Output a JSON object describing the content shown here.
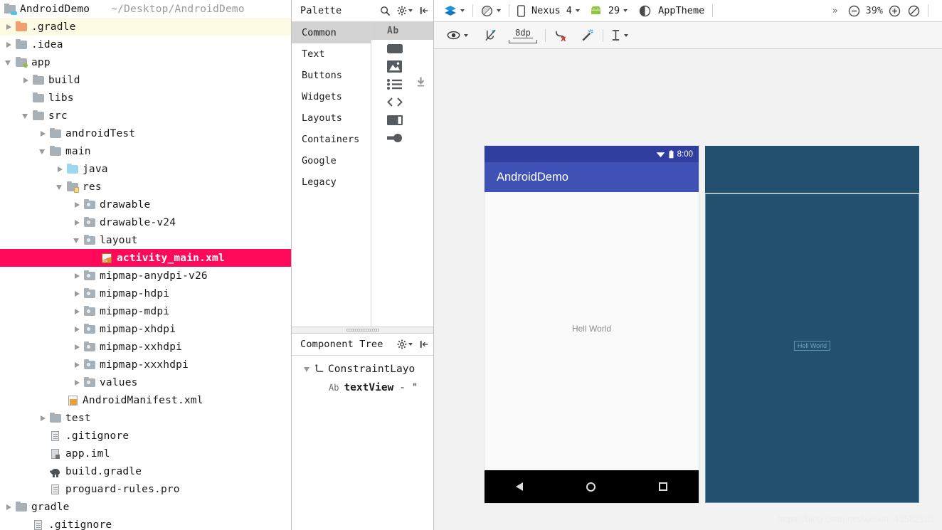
{
  "project": {
    "root_name": "AndroidDemo",
    "root_path": "~/Desktop/AndroidDemo",
    "tree": [
      {
        "label": ".gradle",
        "indent": 0,
        "arrow": "right",
        "icon": "folder-orange",
        "hl": "yellow"
      },
      {
        "label": ".idea",
        "indent": 0,
        "arrow": "right",
        "icon": "folder",
        "hl": "none"
      },
      {
        "label": "app",
        "indent": 0,
        "arrow": "down",
        "icon": "folder-module",
        "hl": "none"
      },
      {
        "label": "build",
        "indent": 1,
        "arrow": "right",
        "icon": "folder",
        "hl": "none"
      },
      {
        "label": "libs",
        "indent": 1,
        "arrow": "none",
        "icon": "folder",
        "hl": "none"
      },
      {
        "label": "src",
        "indent": 1,
        "arrow": "down",
        "icon": "folder",
        "hl": "none"
      },
      {
        "label": "androidTest",
        "indent": 2,
        "arrow": "right",
        "icon": "folder",
        "hl": "none"
      },
      {
        "label": "main",
        "indent": 2,
        "arrow": "down",
        "icon": "folder",
        "hl": "none"
      },
      {
        "label": "java",
        "indent": 3,
        "arrow": "right",
        "icon": "folder-blue",
        "hl": "none"
      },
      {
        "label": "res",
        "indent": 3,
        "arrow": "down",
        "icon": "folder-res",
        "hl": "none"
      },
      {
        "label": "drawable",
        "indent": 4,
        "arrow": "right",
        "icon": "folder-resdir",
        "hl": "none"
      },
      {
        "label": "drawable-v24",
        "indent": 4,
        "arrow": "right",
        "icon": "folder-resdir",
        "hl": "none"
      },
      {
        "label": "layout",
        "indent": 4,
        "arrow": "down",
        "icon": "folder-resdir",
        "hl": "none"
      },
      {
        "label": "activity_main.xml",
        "indent": 5,
        "arrow": "none",
        "icon": "xml-layout",
        "hl": "pink"
      },
      {
        "label": "mipmap-anydpi-v26",
        "indent": 4,
        "arrow": "right",
        "icon": "folder-resdir",
        "hl": "none"
      },
      {
        "label": "mipmap-hdpi",
        "indent": 4,
        "arrow": "right",
        "icon": "folder-resdir",
        "hl": "none"
      },
      {
        "label": "mipmap-mdpi",
        "indent": 4,
        "arrow": "right",
        "icon": "folder-resdir",
        "hl": "none"
      },
      {
        "label": "mipmap-xhdpi",
        "indent": 4,
        "arrow": "right",
        "icon": "folder-resdir",
        "hl": "none"
      },
      {
        "label": "mipmap-xxhdpi",
        "indent": 4,
        "arrow": "right",
        "icon": "folder-resdir",
        "hl": "none"
      },
      {
        "label": "mipmap-xxxhdpi",
        "indent": 4,
        "arrow": "right",
        "icon": "folder-resdir",
        "hl": "none"
      },
      {
        "label": "values",
        "indent": 4,
        "arrow": "right",
        "icon": "folder-resdir",
        "hl": "none"
      },
      {
        "label": "AndroidManifest.xml",
        "indent": 3,
        "arrow": "none",
        "icon": "manifest",
        "hl": "none"
      },
      {
        "label": "test",
        "indent": 2,
        "arrow": "right",
        "icon": "folder",
        "hl": "none"
      },
      {
        "label": ".gitignore",
        "indent": 2,
        "arrow": "none",
        "icon": "file",
        "hl": "none"
      },
      {
        "label": "app.iml",
        "indent": 2,
        "arrow": "none",
        "icon": "iml",
        "hl": "none"
      },
      {
        "label": "build.gradle",
        "indent": 2,
        "arrow": "none",
        "icon": "gradle",
        "hl": "none"
      },
      {
        "label": "proguard-rules.pro",
        "indent": 2,
        "arrow": "none",
        "icon": "file",
        "hl": "none"
      },
      {
        "label": "gradle",
        "indent": 0,
        "arrow": "right",
        "icon": "folder",
        "hl": "none"
      },
      {
        "label": ".gitignore",
        "indent": 1,
        "arrow": "none",
        "icon": "file",
        "hl": "none"
      }
    ]
  },
  "palette": {
    "title": "Palette",
    "search_icon": "search-icon",
    "settings_icon": "gear-icon",
    "collapse_icon": "collapse-panel-icon",
    "categories": [
      {
        "label": "Common",
        "selected": true
      },
      {
        "label": "Text",
        "selected": false
      },
      {
        "label": "Buttons",
        "selected": false
      },
      {
        "label": "Widgets",
        "selected": false
      },
      {
        "label": "Layouts",
        "selected": false
      },
      {
        "label": "Containers",
        "selected": false
      },
      {
        "label": "Google",
        "selected": false
      },
      {
        "label": "Legacy",
        "selected": false
      }
    ],
    "widgets": [
      {
        "label": "Ab",
        "icon": "textview-icon",
        "selected": true
      },
      {
        "label": "",
        "icon": "button-icon",
        "selected": false
      },
      {
        "label": "",
        "icon": "imageview-icon",
        "selected": false
      },
      {
        "label": "",
        "icon": "recyclerview-icon",
        "selected": false
      },
      {
        "label": "",
        "icon": "fragment-icon",
        "selected": false
      },
      {
        "label": "",
        "icon": "scrollview-icon",
        "selected": false
      },
      {
        "label": "",
        "icon": "switch-icon",
        "selected": false
      }
    ],
    "download_icon": "download-icon"
  },
  "component_tree": {
    "title": "Component Tree",
    "settings_icon": "gear-icon",
    "collapse_icon": "collapse-panel-icon",
    "nodes": [
      {
        "label": "ConstraintLayo",
        "icon": "constraintlayout-icon",
        "arrow": "down",
        "bold": false,
        "suffix": ""
      },
      {
        "label": "textView",
        "icon": "textview-ab-icon",
        "arrow": "none",
        "bold": true,
        "suffix": "- \""
      }
    ]
  },
  "toolbar": {
    "layers_label": "layers-icon",
    "orientation_label": "orientation-icon",
    "device_icon": "phone-icon",
    "device": "Nexus 4",
    "api_icon": "android-icon",
    "api_level": "29",
    "theme_icon": "theme-contrast-icon",
    "theme": "AppTheme",
    "overflow": "»",
    "zoom_out_icon": "zoom-out-icon",
    "zoom_level": "39%",
    "zoom_in_icon": "zoom-in-icon",
    "zoom_fit_icon": "zoom-fit-icon"
  },
  "toolbar2": {
    "visibility_icon": "eye-icon",
    "autoconnect_icon": "autoconnect-off-icon",
    "default_margin": "8dp",
    "clear_constraints_icon": "clear-constraints-icon",
    "infer_constraints_icon": "magic-wand-icon",
    "guidelines_icon": "guidelines-icon"
  },
  "preview": {
    "status_time": "8:00",
    "wifi_icon": "wifi-icon",
    "battery_icon": "battery-icon",
    "app_title": "AndroidDemo",
    "text_view_content": "Hell World",
    "nav_back_icon": "nav-back-icon",
    "nav_home_icon": "nav-home-icon",
    "nav_recents_icon": "nav-recents-icon"
  },
  "blueprint": {
    "text_view_content": "Hell World"
  },
  "watermark": "https://blog.csdn.net/weixin_43582101",
  "colors": {
    "selection_pink": "#ff0a5a",
    "status_bar": "#303f9f",
    "app_bar": "#3f51b5",
    "blueprint_bg": "#24506f",
    "blueprint_stroke": "#5d91b5",
    "highlight_yellow": "#fdfbe4"
  }
}
